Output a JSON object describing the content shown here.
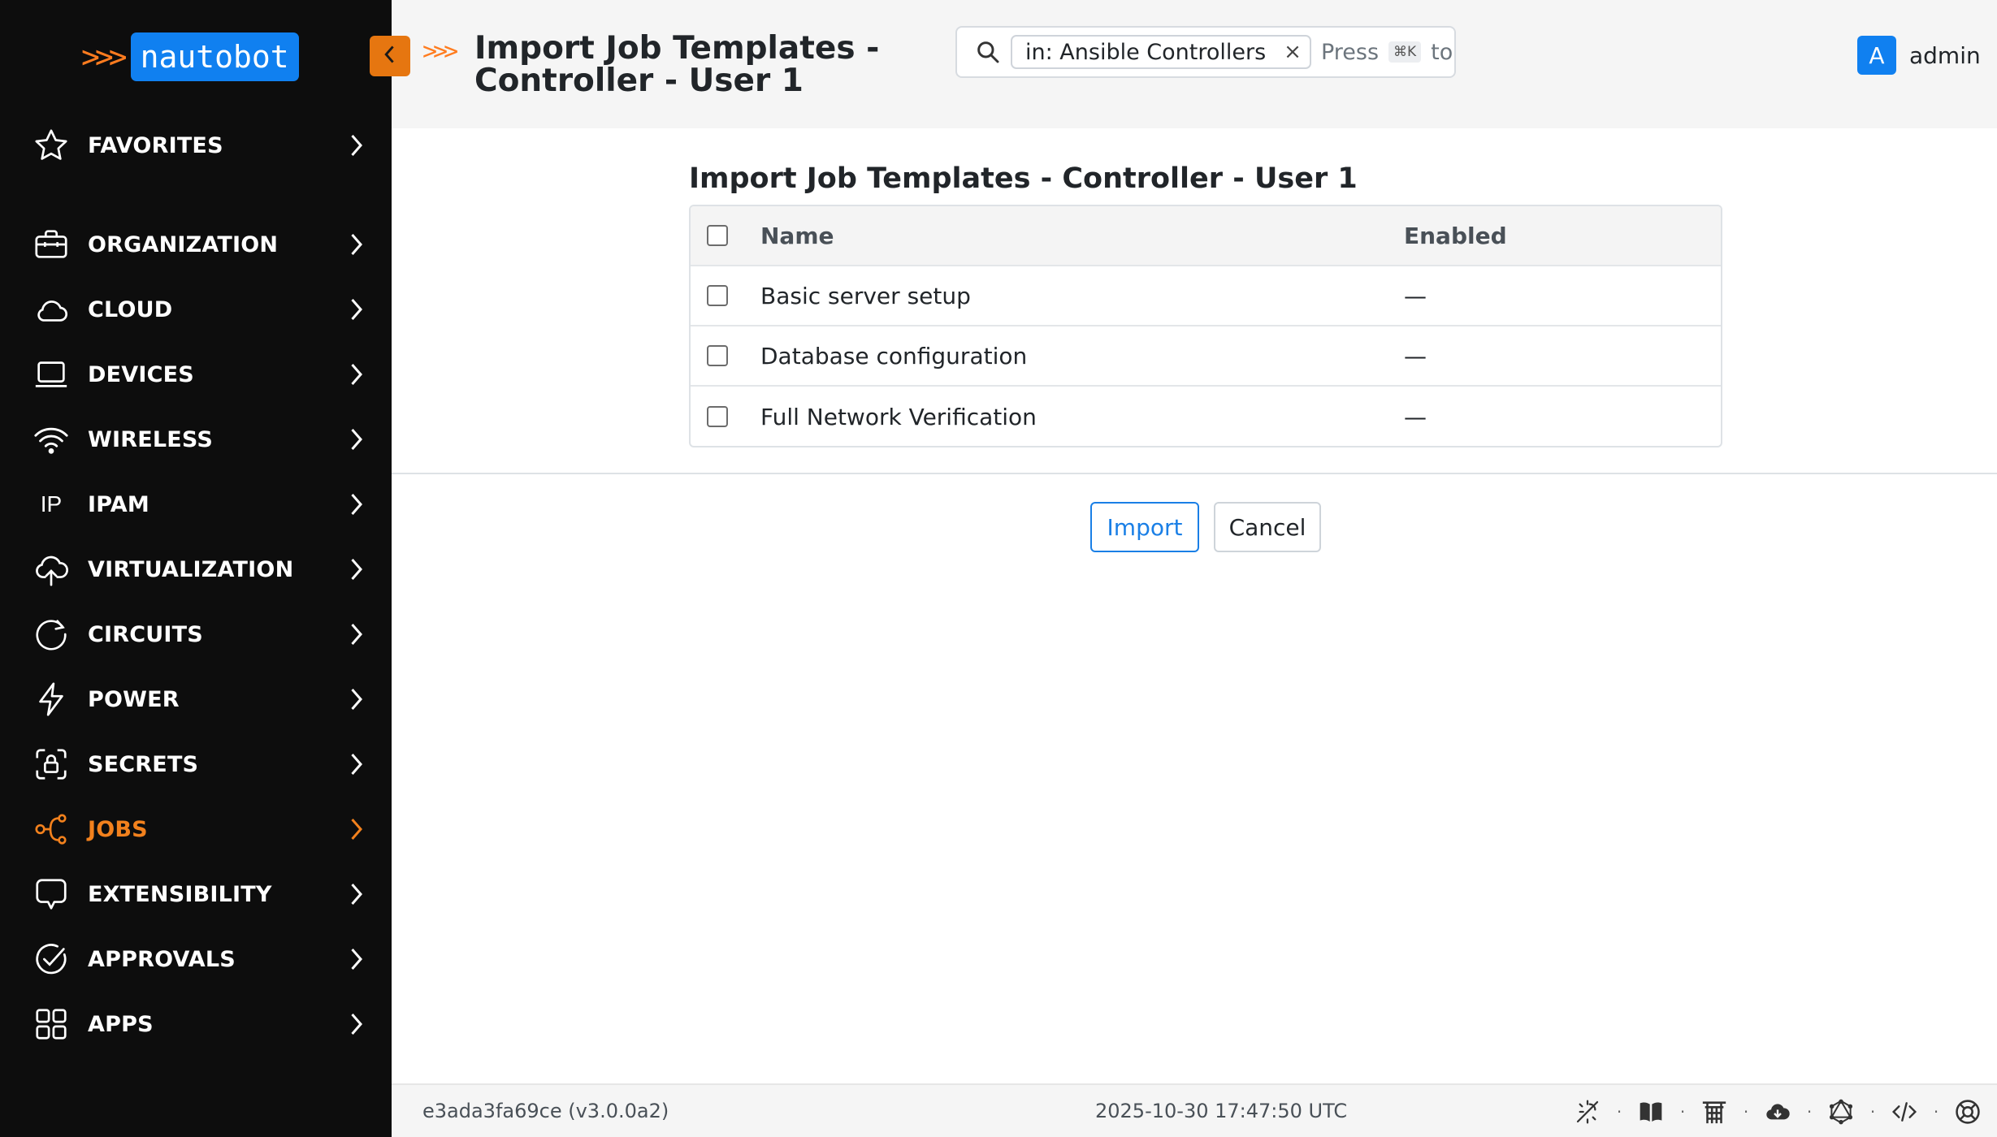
{
  "brand": {
    "chevrons": ">>>",
    "name": "nautobot"
  },
  "sidebar": {
    "items": [
      {
        "label": "FAVORITES",
        "icon": "star-icon"
      },
      {
        "label": "ORGANIZATION",
        "icon": "briefcase-icon"
      },
      {
        "label": "CLOUD",
        "icon": "cloud-icon"
      },
      {
        "label": "DEVICES",
        "icon": "laptop-icon"
      },
      {
        "label": "WIRELESS",
        "icon": "wifi-icon"
      },
      {
        "label": "IPAM",
        "icon": "ip-icon",
        "glyph": "IP"
      },
      {
        "label": "VIRTUALIZATION",
        "icon": "cloud-upload-icon"
      },
      {
        "label": "CIRCUITS",
        "icon": "circuit-icon"
      },
      {
        "label": "POWER",
        "icon": "lightning-icon"
      },
      {
        "label": "SECRETS",
        "icon": "lock-icon"
      },
      {
        "label": "JOBS",
        "icon": "jobs-icon",
        "active": true
      },
      {
        "label": "EXTENSIBILITY",
        "icon": "extensibility-icon"
      },
      {
        "label": "APPROVALS",
        "icon": "check-circle-icon"
      },
      {
        "label": "APPS",
        "icon": "grid-icon"
      }
    ],
    "active_color": "#f2811d"
  },
  "header": {
    "title_chevrons": ">>>",
    "title": "Import Job Templates - Controller - User 1",
    "search": {
      "chip": "in: Ansible Controllers",
      "chip_close": "×",
      "hint_prefix": "Press",
      "kbd": "⌘K",
      "hint_suffix": "to se"
    },
    "user": {
      "initial": "A",
      "name": "admin"
    }
  },
  "main": {
    "title": "Import Job Templates - Controller - User 1",
    "table": {
      "columns": [
        "Name",
        "Enabled"
      ],
      "rows": [
        {
          "name": "Basic server setup",
          "enabled": "—"
        },
        {
          "name": "Database configuration",
          "enabled": "—"
        },
        {
          "name": "Full Network Verification",
          "enabled": "—"
        }
      ]
    },
    "buttons": {
      "import": "Import",
      "cancel": "Cancel"
    }
  },
  "footer": {
    "version": "e3ada3fa69ce (v3.0.0a2)",
    "timestamp": "2025-10-30 17:47:50 UTC",
    "separator": "·",
    "icons": [
      "theme-toggle-icon",
      "docs-book-icon",
      "api-icon",
      "cloud-download-icon",
      "graphql-icon",
      "code-icon",
      "help-icon"
    ]
  },
  "colors": {
    "sidebar_bg": "#0d0d0d",
    "accent_orange": "#f2811d",
    "primary_blue": "#1080f0"
  }
}
